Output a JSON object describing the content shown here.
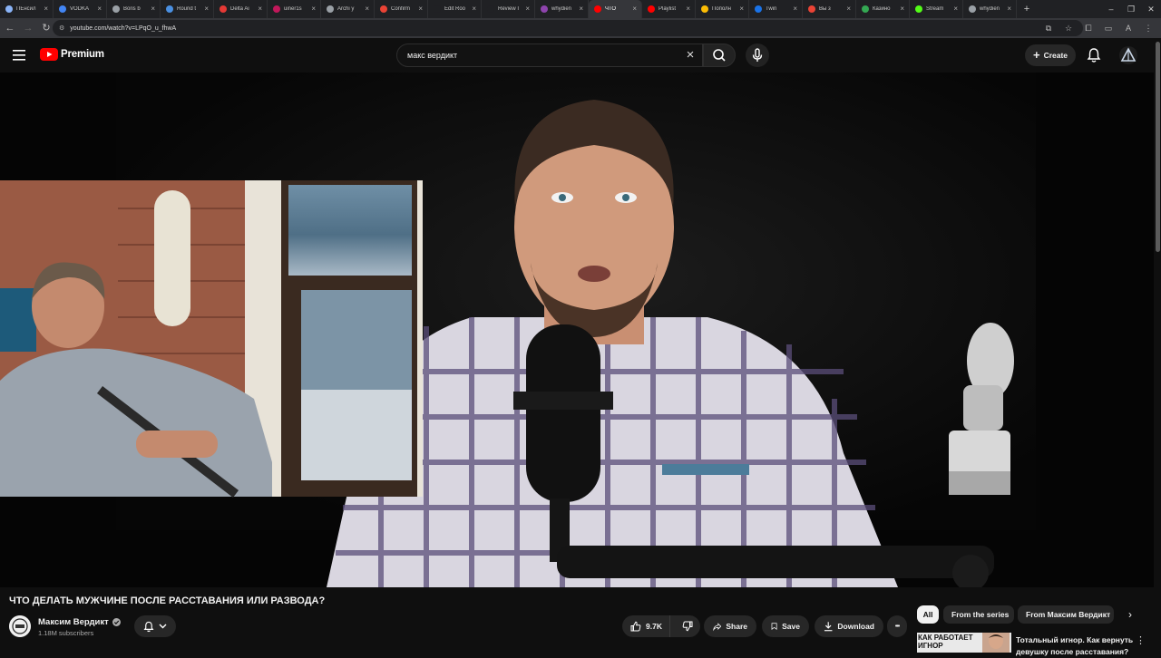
{
  "browser": {
    "tabs": [
      {
        "label": "ПЕнсил",
        "color": "#8ab4f8"
      },
      {
        "label": "VODKA",
        "color": "#4285f4"
      },
      {
        "label": "Boris b",
        "color": "#9aa0a6"
      },
      {
        "label": "Round t",
        "color": "#4a90e2"
      },
      {
        "label": "Delta Ai",
        "color": "#e53935"
      },
      {
        "label": "uiner1s",
        "color": "#c2185b"
      },
      {
        "label": "Archi y",
        "color": "#9aa0a6"
      },
      {
        "label": "Confirm",
        "color": "#ea4335"
      },
      {
        "label": "Edit Roo",
        "color": "#202124"
      },
      {
        "label": "Review I",
        "color": "#202124"
      },
      {
        "label": "whydien",
        "color": "#8e44ad"
      },
      {
        "label": "ЧТО",
        "color": "#ff0000"
      },
      {
        "label": "Playlist",
        "color": "#ff0000"
      },
      {
        "label": "Пополн",
        "color": "#fbbc04"
      },
      {
        "label": "Twin",
        "color": "#1a73e8"
      },
      {
        "label": "Вы з",
        "color": "#ea4335"
      },
      {
        "label": "Казино",
        "color": "#34a853"
      },
      {
        "label": "Stream",
        "color": "#53fc18"
      },
      {
        "label": "whydien",
        "color": "#9aa0a6"
      }
    ],
    "active_tab_index": 11,
    "new_tab": "+",
    "url": "youtube.com/watch?v=LPqO_u_fhwA"
  },
  "header": {
    "logo_text": "Premium",
    "search_value": "макс вердикт",
    "create_label": "Create",
    "brand_red": "#ff0000"
  },
  "video": {
    "title": "ЧТО ДЕЛАТЬ МУЖЧИНЕ ПОСЛЕ РАССТАВАНИЯ ИЛИ РАЗВОДА?",
    "channel": "Максим Вердикт",
    "subscribers": "1.18M subscribers",
    "likes": "9.7K",
    "share_label": "Share",
    "save_label": "Save",
    "download_label": "Download",
    "more_label": "•••"
  },
  "sidebar": {
    "chips": [
      "All",
      "From the series",
      "From Максим Вердикт"
    ],
    "suggested": {
      "thumb_text": "КАК РАБОТАЕТ ИГНОР",
      "title": "Тотальный игнор. Как вернуть девушку после расставания?"
    }
  }
}
